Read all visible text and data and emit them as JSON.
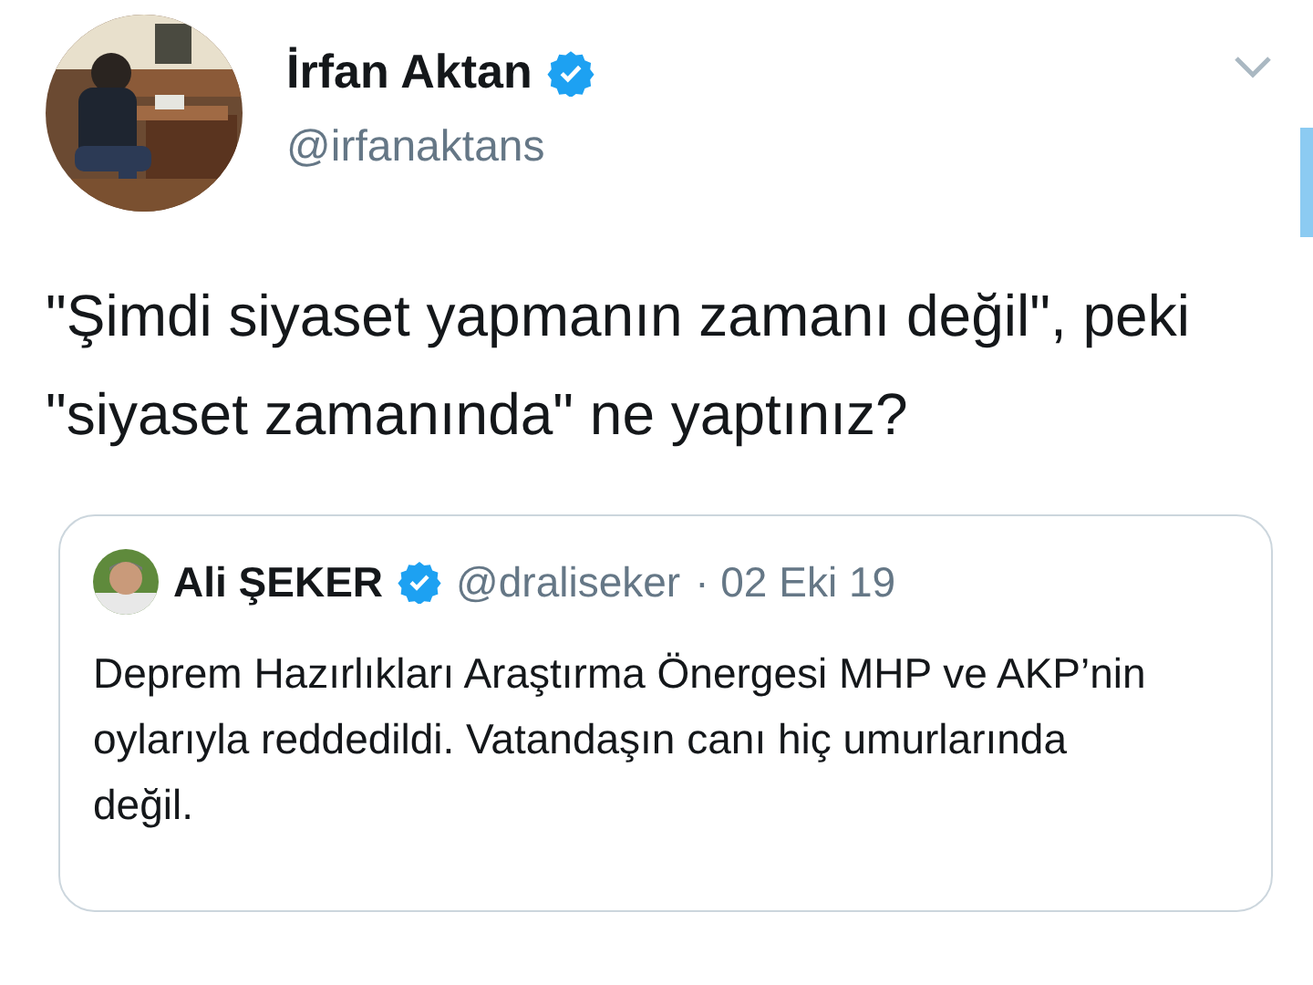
{
  "author": {
    "name": "İrfan Aktan",
    "verified": true,
    "handle": "@irfanaktans"
  },
  "tweet_text": "\"Şimdi siyaset yapmanın zamanı değil\", peki \"siyaset zamanında\" ne yaptınız?",
  "quoted_tweet": {
    "author": {
      "name": "Ali ŞEKER",
      "verified": true,
      "handle": "@draliseker"
    },
    "date": "· 02 Eki 19",
    "text": "Deprem Hazırlıkları Araştırma Önergesi MHP ve AKP’nin oylarıyla reddedildi. Vatandaşın canı hiç umurlarında değil."
  }
}
